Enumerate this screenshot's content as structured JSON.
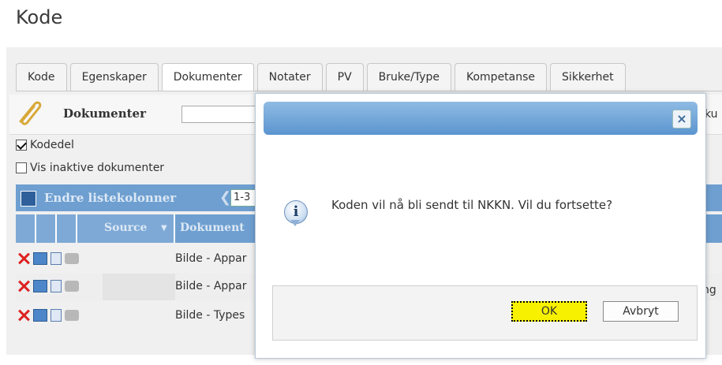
{
  "page": {
    "title": "Kode"
  },
  "tabs": [
    {
      "label": "Kode"
    },
    {
      "label": "Egenskaper"
    },
    {
      "label": "Dokumenter",
      "active": true
    },
    {
      "label": "Notater"
    },
    {
      "label": "PV"
    },
    {
      "label": "Bruke/Type"
    },
    {
      "label": "Kompetanse"
    },
    {
      "label": "Sikkerhet"
    }
  ],
  "toolbar": {
    "label": "Dokumenter",
    "truncated_right": "ku"
  },
  "filters": {
    "kodedel": {
      "label": "Kodedel",
      "checked": true
    },
    "inactive": {
      "label": "Vis inaktive dokumenter",
      "checked": false
    }
  },
  "listbar": {
    "label": "Endre listekolonner",
    "pager_value": "1-3"
  },
  "table": {
    "headers": {
      "source": "Source",
      "document": "Dokument"
    },
    "rows": [
      {
        "text": "Bilde - Appar"
      },
      {
        "text": "Bilde - Appar",
        "trailing": "ng"
      },
      {
        "text": "Bilde - Types"
      }
    ]
  },
  "dialog": {
    "message": "Koden vil nå bli sendt til NKKN. Vil du fortsette?",
    "close_glyph": "×",
    "info_glyph": "i",
    "ok_label": "OK",
    "cancel_label": "Avbryt"
  },
  "colors": {
    "accent": "#6e9fd0",
    "ok_highlight": "#f7f100",
    "delete": "#dd2222"
  }
}
